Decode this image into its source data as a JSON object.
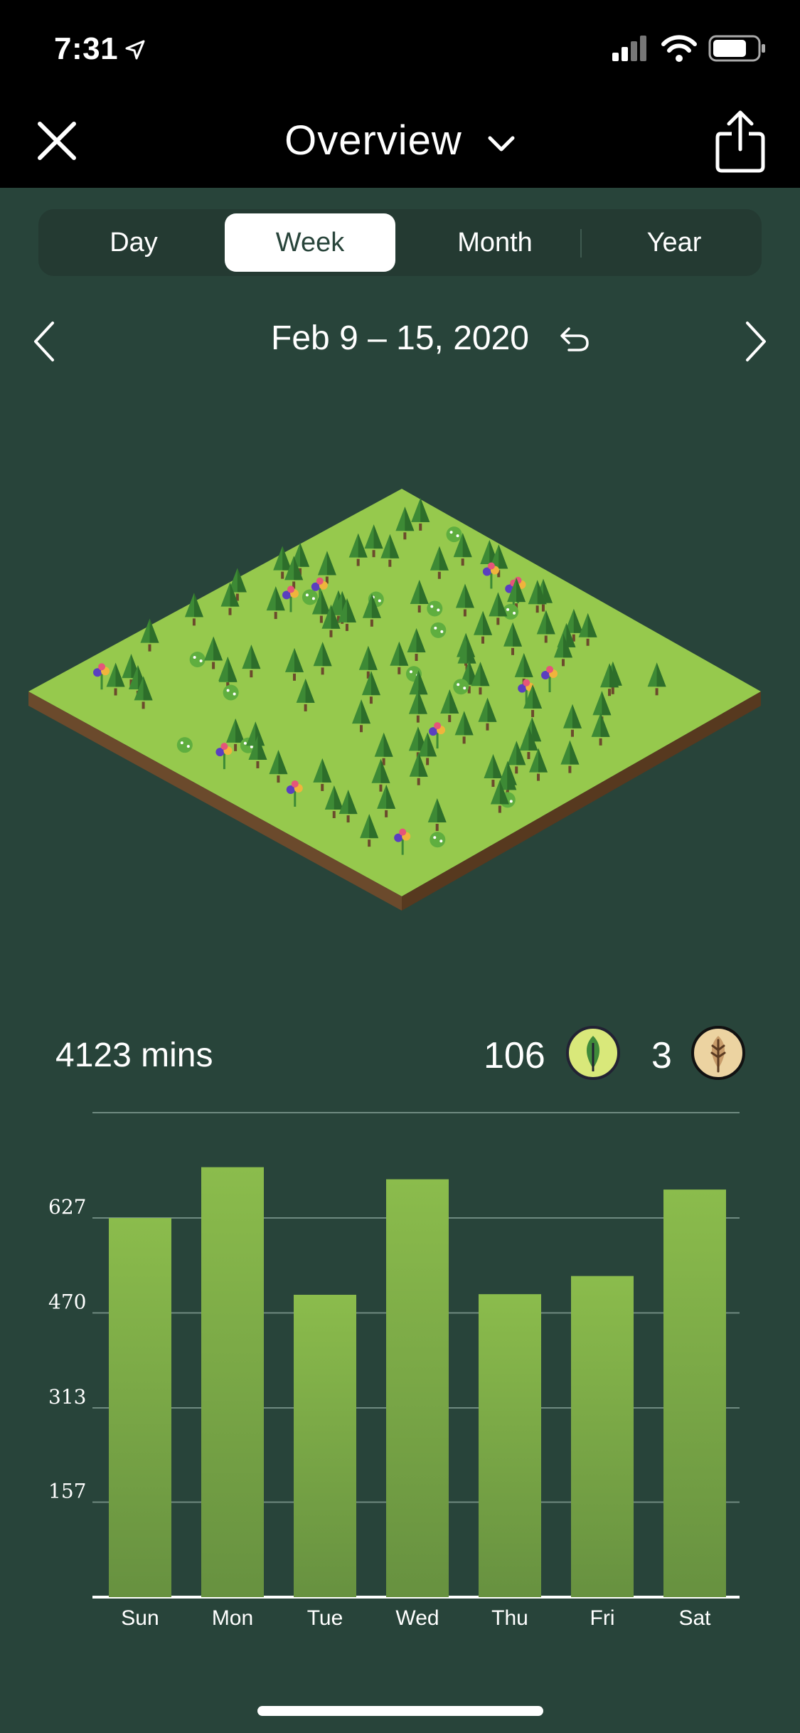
{
  "status": {
    "time": "7:31"
  },
  "nav": {
    "title": "Overview"
  },
  "tabs": [
    {
      "label": "Day",
      "active": false
    },
    {
      "label": "Week",
      "active": true
    },
    {
      "label": "Month",
      "active": false
    },
    {
      "label": "Year",
      "active": false
    }
  ],
  "date_range": "Feb 9 – 15, 2020",
  "stats": {
    "total_mins": "4123 mins",
    "healthy_trees": "106",
    "dead_trees": "3"
  },
  "colors": {
    "background": "#28443a",
    "bar": "#7fae44",
    "active_tab": "#ffffff"
  },
  "chart_data": {
    "type": "bar",
    "categories": [
      "Sun",
      "Mon",
      "Tue",
      "Wed",
      "Thu",
      "Fri",
      "Sat"
    ],
    "values": [
      627,
      711,
      500,
      691,
      501,
      531,
      674
    ],
    "yticks": [
      157,
      313,
      470,
      627
    ],
    "ylim": [
      0,
      800
    ],
    "xlabel": "",
    "ylabel": ""
  }
}
